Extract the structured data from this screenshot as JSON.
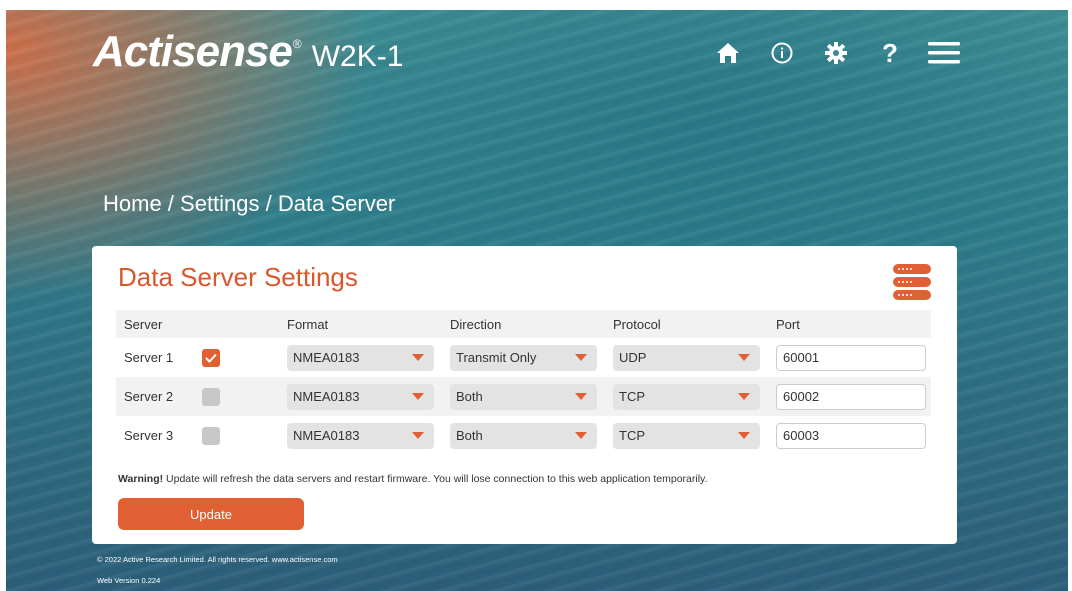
{
  "header": {
    "brand": "Actisense",
    "reg_mark": "®",
    "model": "W2K-1",
    "nav": [
      {
        "icon": "home-icon"
      },
      {
        "icon": "info-icon"
      },
      {
        "icon": "gear-icon"
      },
      {
        "icon": "help-icon",
        "glyph": "?"
      },
      {
        "icon": "menu-icon"
      }
    ]
  },
  "breadcrumb": {
    "home": "Home",
    "sep1": " / ",
    "settings": "Settings",
    "sep2": " / ",
    "current": "Data Server"
  },
  "card": {
    "title": "Data Server Settings",
    "icon": "database-icon",
    "columns": [
      "Server",
      "Format",
      "Direction",
      "Protocol",
      "Port"
    ],
    "rows": [
      {
        "server": "Server 1",
        "enabled": true,
        "format": "NMEA0183",
        "direction": "Transmit Only",
        "protocol": "UDP",
        "port": "60001"
      },
      {
        "server": "Server 2",
        "enabled": false,
        "format": "NMEA0183",
        "direction": "Both",
        "protocol": "TCP",
        "port": "60002"
      },
      {
        "server": "Server 3",
        "enabled": false,
        "format": "NMEA0183",
        "direction": "Both",
        "protocol": "TCP",
        "port": "60003"
      }
    ],
    "warning_label": "Warning!",
    "warning_text": " Update will refresh the data servers and restart firmware. You will lose connection to this web application temporarily.",
    "update_label": "Update"
  },
  "footer": {
    "copyright": "© 2022 Active Research Limited. All rights reserved.  www.actisense.com",
    "version": "Web Version 0.224"
  },
  "colors": {
    "accent": "#e06033",
    "title": "#d8582c"
  }
}
